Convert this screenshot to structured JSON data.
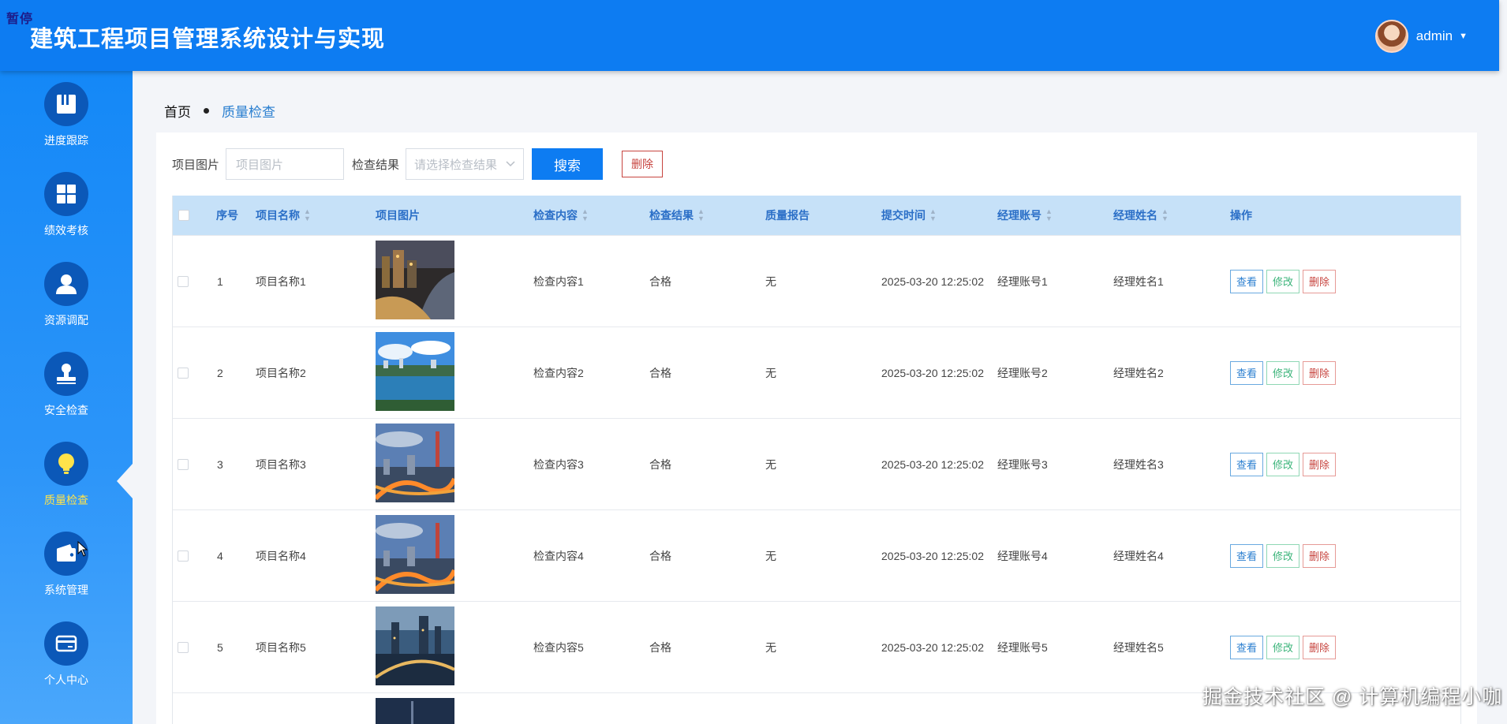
{
  "header": {
    "corner_tag": "暂停",
    "title": "建筑工程项目管理系统设计与实现",
    "user_name": "admin",
    "caret": "▼"
  },
  "sidebar": {
    "items": [
      {
        "label": "进度跟踪",
        "icon": "book-icon",
        "active": false
      },
      {
        "label": "绩效考核",
        "icon": "grid-icon",
        "active": false
      },
      {
        "label": "资源调配",
        "icon": "user-icon",
        "active": false
      },
      {
        "label": "安全检查",
        "icon": "stamp-icon",
        "active": false
      },
      {
        "label": "质量检查",
        "icon": "lightbulb-icon",
        "active": true
      },
      {
        "label": "系统管理",
        "icon": "wallet-icon",
        "active": false
      },
      {
        "label": "个人中心",
        "icon": "card-icon",
        "active": false
      }
    ]
  },
  "breadcrumb": {
    "home": "首页",
    "current": "质量检查"
  },
  "search": {
    "image_label": "项目图片",
    "image_placeholder": "项目图片",
    "result_label": "检查结果",
    "result_placeholder": "请选择检查结果",
    "search_button": "搜索",
    "delete_button": "删除"
  },
  "table": {
    "columns": [
      "序号",
      "项目名称",
      "项目图片",
      "检查内容",
      "检查结果",
      "质量报告",
      "提交时间",
      "经理账号",
      "经理姓名",
      "操作"
    ],
    "rows": [
      {
        "index": "1",
        "name": "项目名称1",
        "content": "检查内容1",
        "result": "合格",
        "report": "无",
        "time": "2025-03-20 12:25:02",
        "account": "经理账号1",
        "manager": "经理姓名1",
        "image": "city-night-river"
      },
      {
        "index": "2",
        "name": "项目名称2",
        "content": "检查内容2",
        "result": "合格",
        "report": "无",
        "time": "2025-03-20 12:25:02",
        "account": "经理账号2",
        "manager": "经理姓名2",
        "image": "city-lake-blue-sky"
      },
      {
        "index": "3",
        "name": "项目名称3",
        "content": "检查内容3",
        "result": "合格",
        "report": "无",
        "time": "2025-03-20 12:25:02",
        "account": "经理账号3",
        "manager": "经理姓名3",
        "image": "city-tower-interchange"
      },
      {
        "index": "4",
        "name": "项目名称4",
        "content": "检查内容4",
        "result": "合格",
        "report": "无",
        "time": "2025-03-20 12:25:02",
        "account": "经理账号4",
        "manager": "经理姓名4",
        "image": "city-tower-interchange"
      },
      {
        "index": "5",
        "name": "项目名称5",
        "content": "检查内容5",
        "result": "合格",
        "report": "无",
        "time": "2025-03-20 12:25:02",
        "account": "经理账号5",
        "manager": "经理姓名5",
        "image": "city-bridge-dusk"
      }
    ],
    "actions": {
      "view": "查看",
      "edit": "修改",
      "delete": "删除"
    }
  },
  "watermark": "掘金技术社区 @ 计算机编程小咖",
  "colors": {
    "header": "#0d7cf2",
    "table_header": "#c6e1f8",
    "active_menu_text": "#ffe34a",
    "delete": "#c7443f",
    "edit": "#3bb47a",
    "view": "#2b7fd0"
  }
}
